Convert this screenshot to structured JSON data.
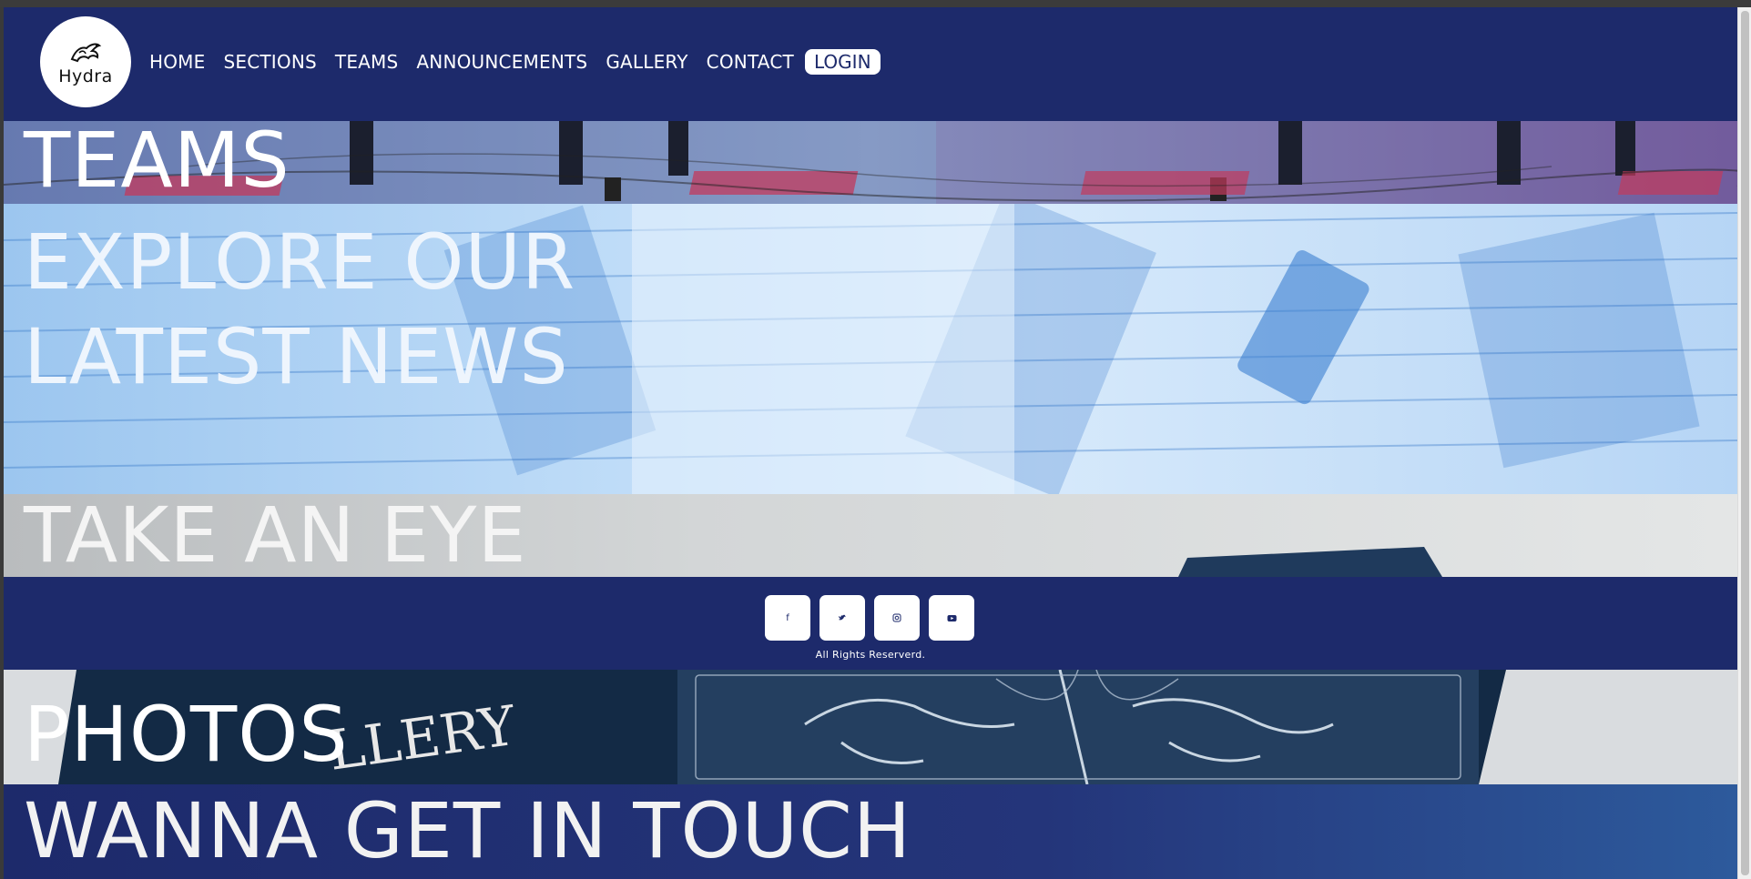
{
  "brand": {
    "logo_text": "Hydra"
  },
  "nav": {
    "links": [
      "HOME",
      "SECTIONS",
      "TEAMS",
      "ANNOUNCEMENTS",
      "GALLERY",
      "CONTACT"
    ],
    "login_label": "LOGIN"
  },
  "sections": {
    "teams_title": "TEAMS",
    "news_title": "EXPLORE OUR LATEST NEWS",
    "eye_title": "TAKE AN EYE",
    "photos_title": "PHOTOS",
    "contact_title": "WANNA GET IN TOUCH"
  },
  "footer": {
    "social_icons": [
      {
        "name": "facebook-icon",
        "glyph": "f"
      },
      {
        "name": "twitter-icon",
        "glyph": "🐦"
      },
      {
        "name": "instagram-icon",
        "glyph": "◎"
      },
      {
        "name": "youtube-icon",
        "glyph": "▶"
      }
    ],
    "rights": "All Rights Reserverd."
  },
  "colors": {
    "header_bg": "#1d2a6b",
    "accent_white": "#ffffff"
  }
}
